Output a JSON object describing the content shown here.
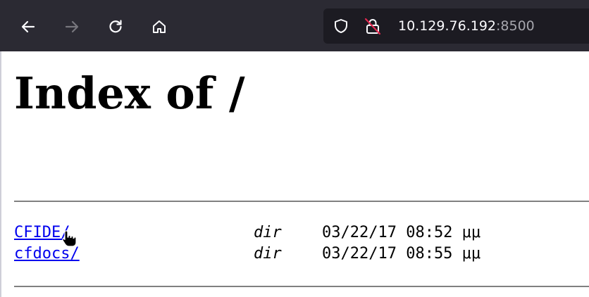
{
  "browser": {
    "url_host": "10.129.76.192",
    "url_port": ":8500",
    "icons": {
      "back": "arrow-left-icon",
      "forward": "arrow-right-icon",
      "reload": "reload-icon",
      "home": "home-icon",
      "tracking": "shield-icon",
      "security": "lock-insecure-icon"
    }
  },
  "page": {
    "title": "Index of /",
    "entries": [
      {
        "name": "CFIDE/",
        "type": "dir",
        "modified": "03/22/17 08:52 μμ"
      },
      {
        "name": "cfdocs/",
        "type": "dir",
        "modified": "03/22/17 08:55 μμ"
      }
    ]
  },
  "colors": {
    "toolbar_bg": "#2b2a33",
    "urlbar_bg": "#1c1b22",
    "link": "#0000ee",
    "insecure_slash": "#e22850"
  }
}
